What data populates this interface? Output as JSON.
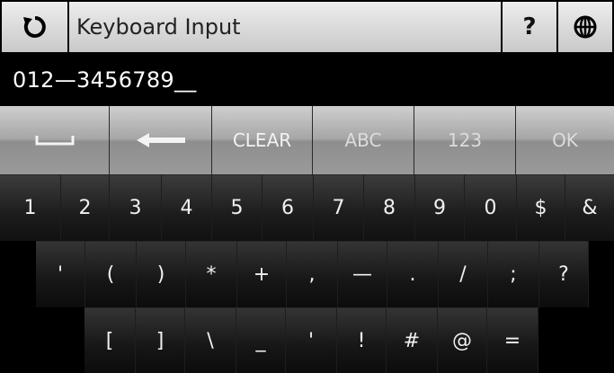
{
  "titlebar": {
    "refresh_icon": "refresh-icon",
    "title": "Keyboard Input",
    "help_label": "?",
    "globe_icon": "globe-icon"
  },
  "input": {
    "value": "012—3456789__"
  },
  "function_keys": {
    "space_icon": "space-bar-icon",
    "backspace_icon": "backspace-arrow-icon",
    "clear": "CLEAR",
    "abc": "ABC",
    "num": "123",
    "ok": "OK"
  },
  "rows": {
    "row1": [
      "1",
      "2",
      "3",
      "4",
      "5",
      "6",
      "7",
      "8",
      "9",
      "0",
      "$",
      "&"
    ],
    "row2": [
      "'",
      "(",
      ")",
      "*",
      "+",
      ",",
      "—",
      ".",
      "/",
      ";",
      "?"
    ],
    "row3": [
      "[",
      "]",
      "\\",
      "_",
      "'",
      "!",
      "#",
      "@",
      "="
    ]
  }
}
